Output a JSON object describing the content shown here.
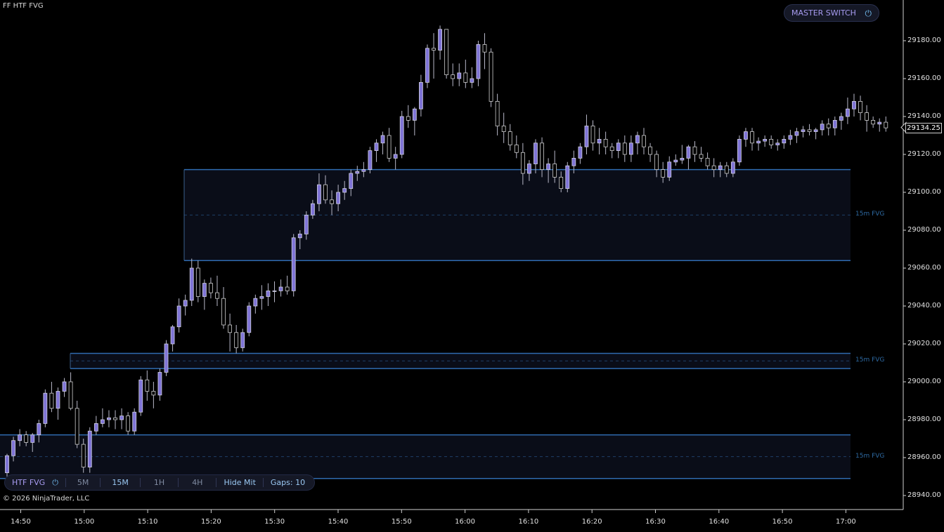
{
  "indicator_label": "FF HTF FVG",
  "copyright": "© 2026 NinjaTrader, LLC",
  "master_switch": {
    "label": "MASTER SWITCH",
    "icon": "power-icon"
  },
  "toolbar": {
    "htf_label": "HTF FVG",
    "tf_5m": "5M",
    "tf_15m": "15M",
    "tf_1h": "1H",
    "tf_4h": "4H",
    "hide_mit": "Hide Mit",
    "gaps": "Gaps: 10"
  },
  "current_price": "29134.25",
  "price_labels": [
    "29180.00",
    "29160.00",
    "29140.00",
    "29120.00",
    "29100.00",
    "29080.00",
    "29060.00",
    "29040.00",
    "29020.00",
    "29000.00",
    "28980.00",
    "28960.00",
    "28940.00"
  ],
  "time_labels": [
    "14:50",
    "15:00",
    "15:10",
    "15:20",
    "15:30",
    "15:40",
    "15:50",
    "16:00",
    "16:10",
    "16:20",
    "16:30",
    "16:40",
    "16:50",
    "17:00"
  ],
  "fvg_zones": [
    {
      "label": "15m FVG",
      "top": 29112,
      "bottom": 29064
    },
    {
      "label": "15m FVG",
      "top": 29015,
      "bottom": 29007
    },
    {
      "label": "15m FVG",
      "top": 28972,
      "bottom": 28949
    }
  ],
  "colors": {
    "bull": "#7f74d6",
    "bear": "#000000",
    "wick": "#b8b8c8",
    "zone_line": "#2f6bb0",
    "zone_fill": "#0a0d18"
  },
  "chart_data": {
    "type": "candlestick",
    "ylim": [
      28936,
      29198
    ],
    "candles": [
      [
        28952,
        28962,
        28950,
        28961
      ],
      [
        28961,
        28971,
        28958,
        28969
      ],
      [
        28969,
        28975,
        28966,
        28972
      ],
      [
        28972,
        28974,
        28966,
        28968
      ],
      [
        28968,
        28973,
        28963,
        28972
      ],
      [
        28972,
        28980,
        28968,
        28978
      ],
      [
        28978,
        28996,
        28976,
        28994
      ],
      [
        28994,
        29000,
        28984,
        28986
      ],
      [
        28986,
        28997,
        28980,
        28995
      ],
      [
        28995,
        29002,
        28992,
        29000
      ],
      [
        29000,
        29005,
        28985,
        28986
      ],
      [
        28986,
        28990,
        28965,
        28967
      ],
      [
        28967,
        28970,
        28952,
        28955
      ],
      [
        28955,
        28976,
        28952,
        28974
      ],
      [
        28974,
        28982,
        28972,
        28978
      ],
      [
        28978,
        28986,
        28976,
        28980
      ],
      [
        28980,
        28985,
        28976,
        28981
      ],
      [
        28981,
        28985,
        28975,
        28980
      ],
      [
        28980,
        28986,
        28975,
        28982
      ],
      [
        28982,
        28984,
        28972,
        28974
      ],
      [
        28974,
        28986,
        28972,
        28984
      ],
      [
        28984,
        29003,
        28982,
        29001
      ],
      [
        29001,
        29006,
        28990,
        28995
      ],
      [
        28995,
        29000,
        28986,
        28993
      ],
      [
        28993,
        29007,
        28990,
        29005
      ],
      [
        29005,
        29022,
        29003,
        29020
      ],
      [
        29020,
        29030,
        29016,
        29029
      ],
      [
        29029,
        29044,
        29026,
        29040
      ],
      [
        29040,
        29046,
        29035,
        29043
      ],
      [
        29043,
        29065,
        29040,
        29060
      ],
      [
        29060,
        29064,
        29042,
        29045
      ],
      [
        29045,
        29054,
        29038,
        29052
      ],
      [
        29052,
        29055,
        29044,
        29047
      ],
      [
        29047,
        29056,
        29040,
        29044
      ],
      [
        29044,
        29050,
        29028,
        29030
      ],
      [
        29030,
        29036,
        29016,
        29026
      ],
      [
        29026,
        29030,
        29015,
        29018
      ],
      [
        29018,
        29028,
        29016,
        29026
      ],
      [
        29026,
        29042,
        29024,
        29040
      ],
      [
        29040,
        29046,
        29036,
        29044
      ],
      [
        29044,
        29051,
        29038,
        29045
      ],
      [
        29045,
        29052,
        29040,
        29048
      ],
      [
        29048,
        29053,
        29042,
        29048
      ],
      [
        29048,
        29054,
        29045,
        29050
      ],
      [
        29050,
        29056,
        29046,
        29048
      ],
      [
        29048,
        29078,
        29045,
        29076
      ],
      [
        29076,
        29080,
        29070,
        29078
      ],
      [
        29078,
        29090,
        29075,
        29088
      ],
      [
        29088,
        29096,
        29086,
        29094
      ],
      [
        29094,
        29110,
        29090,
        29104
      ],
      [
        29104,
        29109,
        29094,
        29096
      ],
      [
        29096,
        29101,
        29088,
        29094
      ],
      [
        29094,
        29104,
        29090,
        29100
      ],
      [
        29100,
        29106,
        29096,
        29102
      ],
      [
        29102,
        29112,
        29098,
        29110
      ],
      [
        29110,
        29114,
        29106,
        29111
      ],
      [
        29111,
        29116,
        29108,
        29112
      ],
      [
        29112,
        29124,
        29110,
        29122
      ],
      [
        29122,
        29128,
        29116,
        29126
      ],
      [
        29126,
        29132,
        29120,
        29130
      ],
      [
        29130,
        29134,
        29116,
        29118
      ],
      [
        29118,
        29124,
        29112,
        29120
      ],
      [
        29120,
        29143,
        29118,
        29140
      ],
      [
        29140,
        29146,
        29134,
        29138
      ],
      [
        29138,
        29145,
        29130,
        29144
      ],
      [
        29144,
        29162,
        29140,
        29158
      ],
      [
        29158,
        29178,
        29155,
        29176
      ],
      [
        29176,
        29184,
        29160,
        29175
      ],
      [
        29175,
        29188,
        29170,
        29186
      ],
      [
        29186,
        29186,
        29160,
        29162
      ],
      [
        29162,
        29168,
        29156,
        29160
      ],
      [
        29160,
        29168,
        29156,
        29163
      ],
      [
        29163,
        29170,
        29155,
        29158
      ],
      [
        29158,
        29166,
        29155,
        29160
      ],
      [
        29160,
        29180,
        29156,
        29178
      ],
      [
        29178,
        29184,
        29165,
        29174
      ],
      [
        29174,
        29176,
        29145,
        29148
      ],
      [
        29148,
        29152,
        29130,
        29135
      ],
      [
        29135,
        29142,
        29126,
        29132
      ],
      [
        29132,
        29136,
        29122,
        29125
      ],
      [
        29125,
        29130,
        29118,
        29121
      ],
      [
        29121,
        29126,
        29104,
        29110
      ],
      [
        29110,
        29117,
        29106,
        29115
      ],
      [
        29115,
        29128,
        29110,
        29126
      ],
      [
        29126,
        29129,
        29108,
        29112
      ],
      [
        29112,
        29118,
        29105,
        29115
      ],
      [
        29115,
        29122,
        29105,
        29108
      ],
      [
        29108,
        29111,
        29100,
        29102
      ],
      [
        29102,
        29116,
        29100,
        29114
      ],
      [
        29114,
        29122,
        29110,
        29118
      ],
      [
        29118,
        29126,
        29115,
        29124
      ],
      [
        29124,
        29141,
        29120,
        29135
      ],
      [
        29135,
        29138,
        29122,
        29126
      ],
      [
        29126,
        29134,
        29120,
        29128
      ],
      [
        29128,
        29132,
        29120,
        29124
      ],
      [
        29124,
        29126,
        29118,
        29122
      ],
      [
        29122,
        29128,
        29118,
        29126
      ],
      [
        29126,
        29130,
        29116,
        29120
      ],
      [
        29120,
        29130,
        29116,
        29126
      ],
      [
        29126,
        29132,
        29120,
        29130
      ],
      [
        29130,
        29134,
        29120,
        29124
      ],
      [
        29124,
        29126,
        29116,
        29120
      ],
      [
        29120,
        29122,
        29108,
        29112
      ],
      [
        29112,
        29116,
        29105,
        29108
      ],
      [
        29108,
        29119,
        29106,
        29116
      ],
      [
        29116,
        29120,
        29114,
        29117
      ],
      [
        29117,
        29125,
        29115,
        29118
      ],
      [
        29118,
        29125,
        29112,
        29124
      ],
      [
        29124,
        29127,
        29116,
        29120
      ],
      [
        29120,
        29124,
        29116,
        29118
      ],
      [
        29118,
        29121,
        29112,
        29114
      ],
      [
        29114,
        29118,
        29108,
        29112
      ],
      [
        29112,
        29116,
        29108,
        29114
      ],
      [
        29114,
        29116,
        29108,
        29110
      ],
      [
        29110,
        29118,
        29108,
        29116
      ],
      [
        29116,
        29130,
        29114,
        29128
      ],
      [
        29128,
        29134,
        29124,
        29132
      ],
      [
        29132,
        29134,
        29122,
        29126
      ],
      [
        29126,
        29129,
        29122,
        29127
      ],
      [
        29127,
        29130,
        29124,
        29128
      ],
      [
        29128,
        29130,
        29123,
        29125
      ],
      [
        29125,
        29128,
        29122,
        29126
      ],
      [
        29126,
        29130,
        29123,
        29128
      ],
      [
        29128,
        29133,
        29125,
        29130
      ],
      [
        29130,
        29134,
        29126,
        29132
      ],
      [
        29132,
        29135,
        29129,
        29133
      ],
      [
        29133,
        29136,
        29130,
        29132
      ],
      [
        29132,
        29134,
        29128,
        29133
      ],
      [
        29133,
        29138,
        29130,
        29136
      ],
      [
        29136,
        29139,
        29130,
        29134
      ],
      [
        29134,
        29140,
        29130,
        29138
      ],
      [
        29138,
        29142,
        29133,
        29140
      ],
      [
        29140,
        29150,
        29136,
        29144
      ],
      [
        29144,
        29152,
        29140,
        29148
      ],
      [
        29148,
        29151,
        29138,
        29142
      ],
      [
        29142,
        29146,
        29132,
        29138
      ],
      [
        29138,
        29140,
        29134,
        29136
      ],
      [
        29136,
        29139,
        29132,
        29137
      ],
      [
        29137,
        29140,
        29132,
        29134
      ]
    ]
  }
}
